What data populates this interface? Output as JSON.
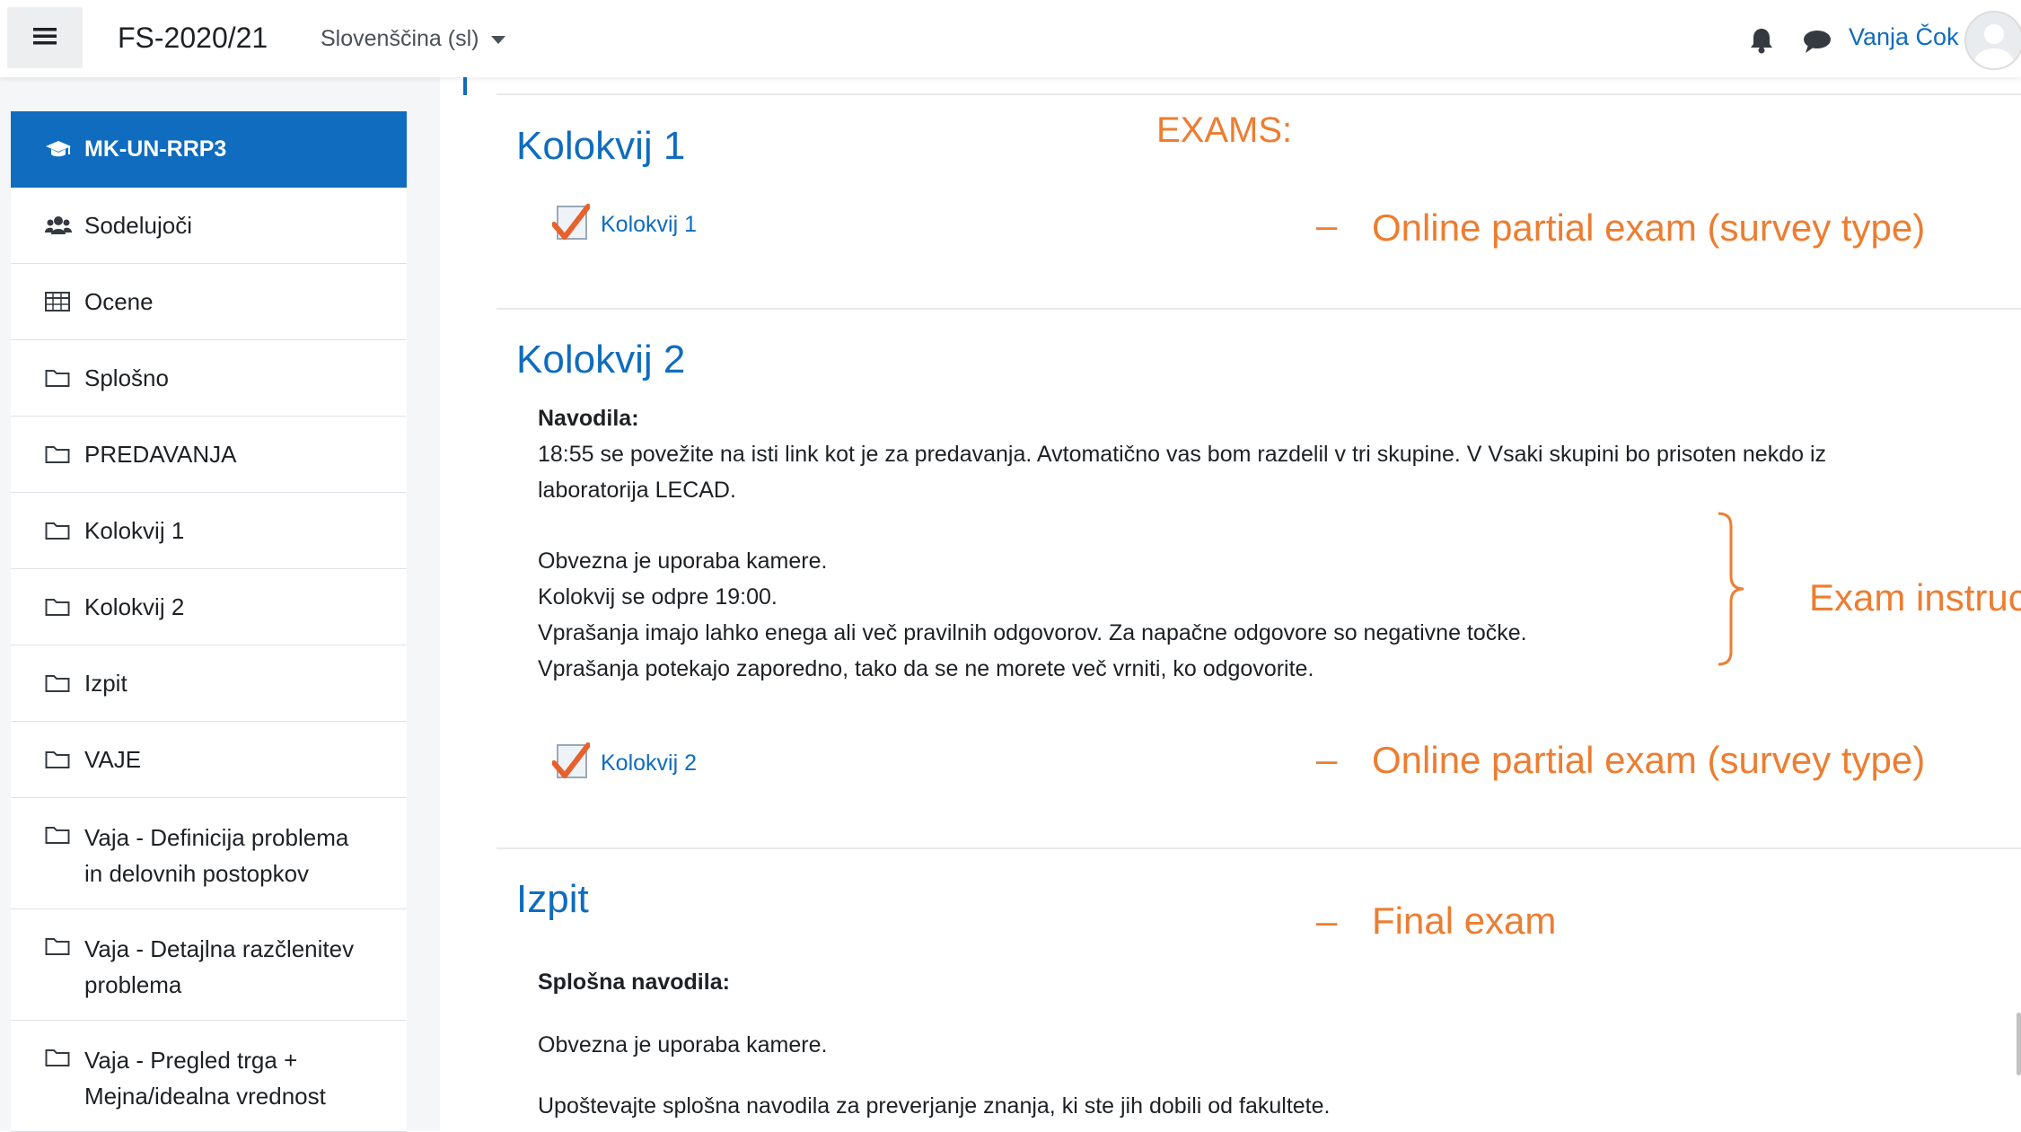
{
  "navbar": {
    "brand": "FS-2020/21",
    "language": "Slovenščina (sl)",
    "username": "Vanja Čok"
  },
  "sidebar": {
    "items": [
      {
        "label": "MK-UN-RRP3",
        "icon": "graduation-cap-icon"
      },
      {
        "label": "Sodelujoči",
        "icon": "users-icon"
      },
      {
        "label": "Ocene",
        "icon": "table-icon"
      },
      {
        "label": "Splošno",
        "icon": "folder-icon"
      },
      {
        "label": "PREDAVANJA",
        "icon": "folder-icon"
      },
      {
        "label": "Kolokvij 1",
        "icon": "folder-icon"
      },
      {
        "label": "Kolokvij 2",
        "icon": "folder-icon"
      },
      {
        "label": "Izpit",
        "icon": "folder-icon"
      },
      {
        "label": "VAJE",
        "icon": "folder-icon"
      },
      {
        "label": "Vaja - Definicija problema\nin delovnih postopkov",
        "icon": "folder-icon"
      },
      {
        "label": "Vaja - Detajlna razčlenitev\nproblema",
        "icon": "folder-icon"
      },
      {
        "label": "Vaja - Pregled trga +\nMejna/idealna vrednost",
        "icon": "folder-icon"
      }
    ]
  },
  "main": {
    "sections": [
      {
        "title": "Kolokvij 1",
        "activity": "Kolokvij 1"
      },
      {
        "title": "Kolokvij 2",
        "instructions_heading": "Navodila:",
        "instructions_lines": [
          "18:55 se povežite na isti link kot je za predavanja. Avtomatično vas bom razdelil v tri skupine. V Vsaki skupini bo prisoten nekdo iz",
          "laboratorija LECAD.",
          "Obvezna je uporaba kamere.",
          "Kolokvij se odpre 19:00.",
          "Vprašanja imajo lahko enega ali več pravilnih odgovorov. Za napačne odgovore so negativne točke.",
          "Vprašanja potekajo zaporedno, tako da se ne morete več vrniti, ko odgovorite."
        ],
        "activity": "Kolokvij 2"
      },
      {
        "title": "Izpit",
        "instructions_heading": "Splošna navodila:",
        "instructions_lines": [
          "Obvezna je uporaba kamere.",
          "Upoštevajte splošna navodila za preverjanje znanja, ki ste jih dobili od fakultete."
        ]
      }
    ]
  },
  "annotations": {
    "exams_title": "EXAMS:",
    "dash": "–",
    "partial_exam_1": "Online partial exam (survey type)",
    "exam_instructions": "Exam instruc",
    "partial_exam_2": "Online partial exam (survey type)",
    "final_exam": "Final exam"
  },
  "colors": {
    "accent": "#0f6cbf",
    "annotation": "#ed7d31"
  }
}
